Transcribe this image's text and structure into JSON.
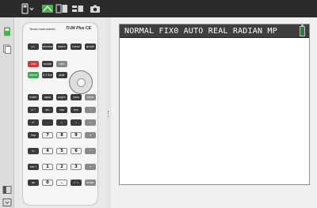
{
  "toolbar": {
    "buttons": [
      {
        "name": "calculator-menu-button",
        "icon": "calculator-icon"
      },
      {
        "name": "keypad-view-button",
        "icon": "keypad-icon"
      },
      {
        "name": "split-view-button",
        "icon": "split-view-icon"
      },
      {
        "name": "screen-view-button",
        "icon": "screen-view-icon"
      },
      {
        "name": "screenshot-button",
        "icon": "camera-icon"
      }
    ],
    "active_color": "#4caf50"
  },
  "calculator": {
    "brand": "Texas Instruments",
    "model": "TI-84 Plus CE",
    "keys": {
      "row1": [
        "y=",
        "window",
        "zoom",
        "trace",
        "graph"
      ],
      "row2": [
        "2nd",
        "mode",
        "del"
      ],
      "row3": [
        "alpha",
        "X,T,θ,n",
        "stat"
      ],
      "row4": [
        "math",
        "apps",
        "prgm",
        "vars",
        "clear"
      ],
      "row5": [
        "x⁻¹",
        "sin",
        "cos",
        "tan",
        "^"
      ],
      "row6": [
        "x²",
        ",",
        "(",
        ")",
        "÷"
      ],
      "row7": [
        "log",
        "7",
        "8",
        "9",
        "×"
      ],
      "row8": [
        "ln",
        "4",
        "5",
        "6",
        "−"
      ],
      "row9": [
        "sto→",
        "1",
        "2",
        "3",
        "+"
      ],
      "row10": [
        "on",
        "0",
        ".",
        "(−)",
        "enter"
      ]
    }
  },
  "screen": {
    "status": "NORMAL FIX0 AUTO REAL RADIAN MP",
    "background": "#ffffff",
    "statusbar_color": "#3f3f3f",
    "battery_color": "#2e7d32"
  }
}
